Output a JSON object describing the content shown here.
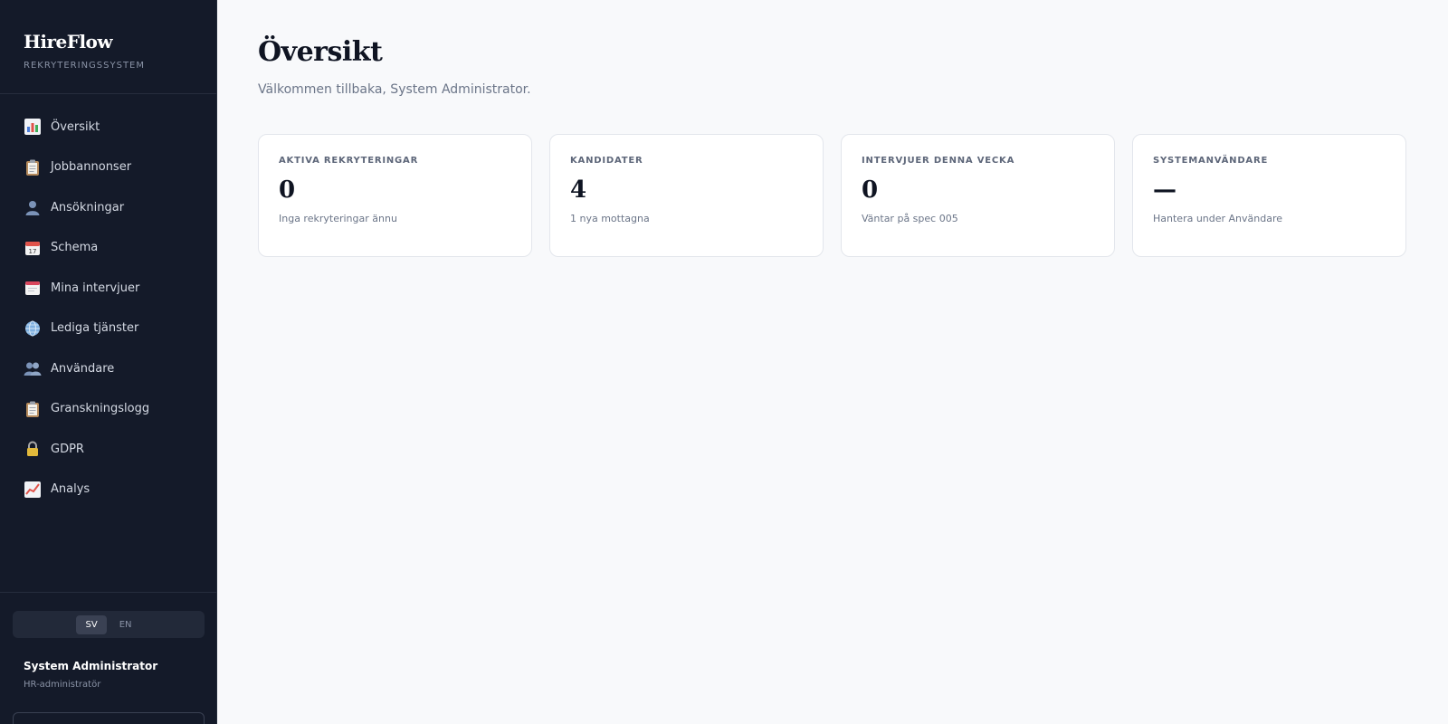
{
  "brand": {
    "name": "HireFlow",
    "subtitle": "REKRYTERINGSSYSTEM"
  },
  "sidebar": {
    "items": [
      {
        "label": "Översikt",
        "icon": "bar-chart-icon"
      },
      {
        "label": "Jobbannonser",
        "icon": "clipboard-icon"
      },
      {
        "label": "Ansökningar",
        "icon": "person-icon"
      },
      {
        "label": "Schema",
        "icon": "calendar-icon"
      },
      {
        "label": "Mina intervjuer",
        "icon": "tear-off-calendar-icon"
      },
      {
        "label": "Lediga tjänster",
        "icon": "globe-icon"
      },
      {
        "label": "Användare",
        "icon": "people-icon"
      },
      {
        "label": "Granskningslogg",
        "icon": "clipboard-icon"
      },
      {
        "label": "GDPR",
        "icon": "lock-icon"
      },
      {
        "label": "Analys",
        "icon": "trend-chart-icon"
      }
    ]
  },
  "language": {
    "sv": "SV",
    "en": "EN",
    "active": "SV"
  },
  "user": {
    "name": "System Administrator",
    "role": "HR-administratör"
  },
  "main": {
    "title": "Översikt",
    "subtitle": "Välkommen tillbaka, System Administrator."
  },
  "cards": [
    {
      "label": "AKTIVA REKRYTERINGAR",
      "value": "0",
      "sub": "Inga rekryteringar ännu"
    },
    {
      "label": "KANDIDATER",
      "value": "4",
      "sub": "1 nya mottagna"
    },
    {
      "label": "INTERVJUER DENNA VECKA",
      "value": "0",
      "sub": "Väntar på spec 005"
    },
    {
      "label": "SYSTEMANVÄNDARE",
      "value": "—",
      "sub": "Hantera under Användare"
    }
  ],
  "colors": {
    "sidebar_bg": "#141a29",
    "main_bg": "#f8f9fb",
    "card_bg": "#ffffff"
  }
}
